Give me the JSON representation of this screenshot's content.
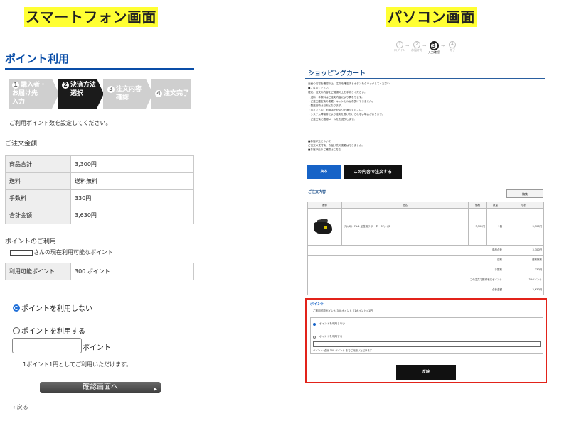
{
  "labels": {
    "smartphone": "スマートフォン画面",
    "pc": "パソコン画面"
  },
  "sp": {
    "heading": "ポイント利用",
    "steps": [
      {
        "num": "1",
        "line1": "購入者・",
        "line2": "お届け先",
        "line3": "入力"
      },
      {
        "num": "2",
        "line1": "決済方法",
        "line2": "選択",
        "line3": ""
      },
      {
        "num": "3",
        "line1": "注文内容",
        "line2": "確認",
        "line3": ""
      },
      {
        "num": "4",
        "line1": "注文完了",
        "line2": "",
        "line3": ""
      }
    ],
    "note": "ご利用ポイント数を設定してください。",
    "amount_title": "ご注文金額",
    "amount_rows": [
      {
        "label": "商品合計",
        "value": "3,300円"
      },
      {
        "label": "送料",
        "value": "送料無料"
      },
      {
        "label": "手数料",
        "value": "330円"
      },
      {
        "label": "合計金額",
        "value": "3,630円"
      }
    ],
    "points_title": "ポイントのご利用",
    "points_owner_suffix": "さんの現在利用可能なポイント",
    "points_row": {
      "label": "利用可能ポイント",
      "value": "300 ポイント"
    },
    "option_no": "ポイントを利用しない",
    "option_yes": "ポイントを利用する",
    "point_unit": "ポイント",
    "point_help": "1ポイント1円としてご利用いただけます。",
    "confirm_button": "確認画面へ",
    "back": "戻る"
  },
  "pc": {
    "steps": [
      {
        "num": "1",
        "label": "ログイン"
      },
      {
        "num": "2",
        "label": "お届け先"
      },
      {
        "num": "3",
        "label": "入力確認"
      },
      {
        "num": "4",
        "label": "完了"
      }
    ],
    "cart_title": "ショッピングカート",
    "intro_lines": [
      "画面の内容を確認の上、注文を確定するボタンをクリックしてください。",
      "■ご注意ください",
      "確定、注文の内容をご確認の上お手続きください。",
      "・送料・手数料はご注文内容により異なります。",
      "・ご注文確定後の変更・キャンセルはお受けできません。",
      "・配送日時は目安となります。",
      "・ポイントのご利用は下記よりお選びください。",
      "・システム障害等により注文を受け付けられない場合があります。",
      "・ご注文後に確認メールをお送りします。"
    ],
    "intro_lines2": [
      "■お届け先について",
      "ご注文の受付後、お届け先の変更はできません。",
      "■お届け先のご確認はこちら"
    ],
    "back_button": "戻る",
    "order_button": "この内容で注文する",
    "order_title": "ご注文内容",
    "edit_button": "編集",
    "table_headers": [
      "画像",
      "品名",
      "価格",
      "数量",
      "小計"
    ],
    "product": {
      "name": "ザムスト FA-1 足首用サポーター Mサイズ",
      "price": "3,300円",
      "qty": "1個",
      "subtotal": "3,300円"
    },
    "summary_rows": [
      {
        "label": "商品合計",
        "value": "3,300円"
      },
      {
        "label": "送料",
        "value": "送料無料"
      },
      {
        "label": "手数料",
        "value": "330円"
      },
      {
        "label": "この注文で獲得予定ポイント",
        "value": "33ポイント"
      },
      {
        "label": "合計金額",
        "value": "3,630円"
      }
    ],
    "point_title": "ポイント",
    "point_available": "ご利用可能ポイント 300ポイント（1ポイント=1円）",
    "option_no": "ポイントを利用しない",
    "option_yes": "ポイントを利用する",
    "point_help": "ポイント: 合計 300 ポイント までご利用いただけます",
    "confirm_button": "反映"
  }
}
